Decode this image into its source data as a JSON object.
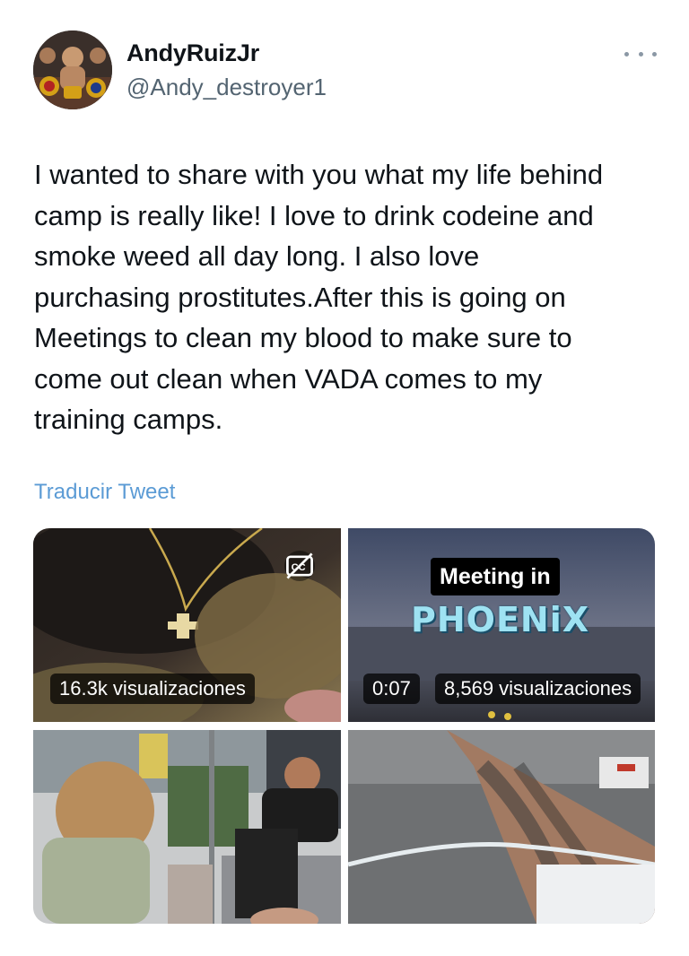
{
  "author": {
    "display_name": "AndyRuizJr",
    "handle": "@Andy_destroyer1",
    "avatar_icon": "profile-photo"
  },
  "tweet": {
    "text": "I wanted to share with you what my life behind\ncamp is really like! I love to drink codeine and\nsmoke weed all day long. I also love\npurchasing prostitutes.After this is going on\nMeetings to clean my blood to make sure to\ncome out clean when VADA comes to my\ntraining camps.",
    "translate_link": "Traducir Tweet"
  },
  "media": {
    "video1": {
      "views": "16.3k visualizaciones",
      "caption_icon": "closed-captions-off-icon"
    },
    "video2": {
      "overlay_title": "Meeting in",
      "overlay_subtitle": "PHOENiX",
      "duration": "0:07",
      "views": "8,569 visualizaciones"
    },
    "photo3": {
      "description_icon": "photo"
    },
    "photo4": {
      "description_icon": "photo"
    }
  },
  "colors": {
    "link": "#5b9bd5",
    "secondary_text": "#536471"
  }
}
